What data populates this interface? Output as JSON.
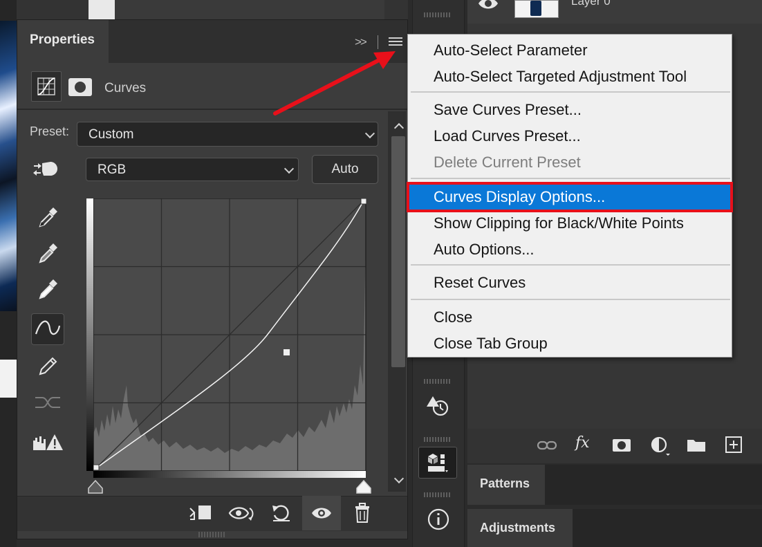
{
  "properties_panel": {
    "title": "Properties",
    "adjustment_name": "Curves",
    "preset_label": "Preset:",
    "preset_value": "Custom",
    "channel_value": "RGB",
    "auto_label": "Auto"
  },
  "layers_panel": {
    "layer_name": "Layer 0"
  },
  "tabs": {
    "patterns": "Patterns",
    "adjustments": "Adjustments"
  },
  "flyout_menu": {
    "items": [
      {
        "label": "Auto-Select Parameter",
        "enabled": true
      },
      {
        "label": "Auto-Select Targeted Adjustment Tool",
        "enabled": true
      },
      {
        "label": "Save Curves Preset...",
        "enabled": true
      },
      {
        "label": "Load Curves Preset...",
        "enabled": true
      },
      {
        "label": "Delete Current Preset",
        "enabled": false
      },
      {
        "label": "Curves Display Options...",
        "enabled": true,
        "highlighted": true
      },
      {
        "label": "Show Clipping for Black/White Points",
        "enabled": true
      },
      {
        "label": "Auto Options...",
        "enabled": true
      },
      {
        "label": "Reset Curves",
        "enabled": true
      },
      {
        "label": "Close",
        "enabled": true
      },
      {
        "label": "Close Tab Group",
        "enabled": true
      }
    ]
  },
  "colors": {
    "menu_highlight": "#0a78d7",
    "annotation_red": "#e8101a"
  }
}
